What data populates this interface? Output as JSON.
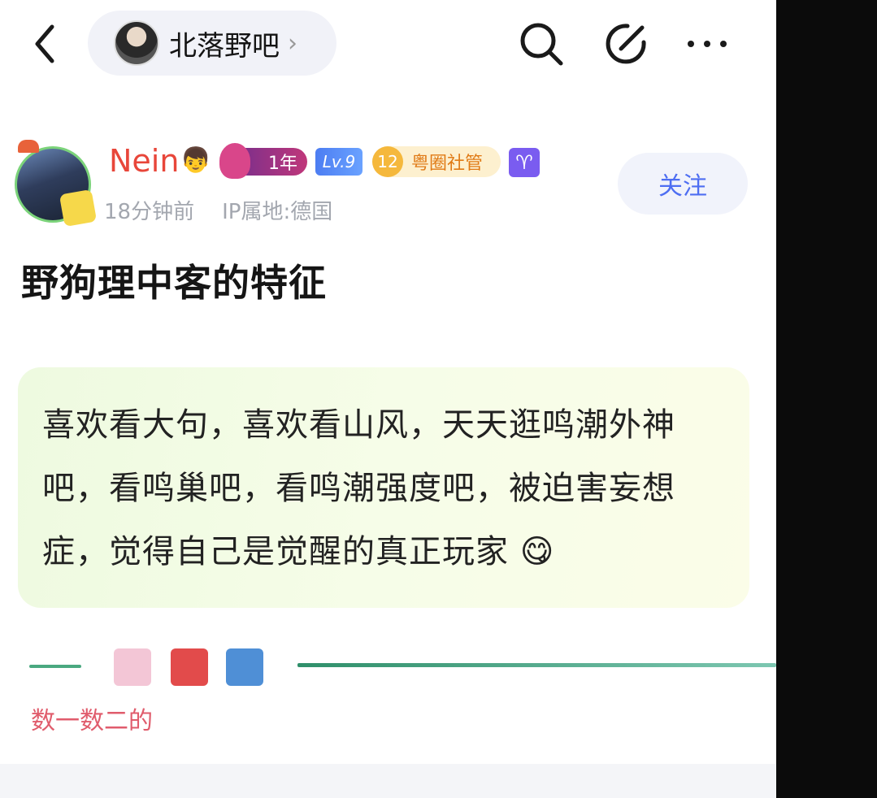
{
  "topbar": {
    "forum_name": "北落野吧",
    "forum_chevron": "›",
    "icons": [
      "back-arrow-icon",
      "search-icon",
      "edit-icon",
      "more-icon"
    ]
  },
  "post": {
    "author": {
      "nickname": "Nein",
      "nickname_emoji": "👦",
      "badge_year": "1年",
      "badge_level": "Lv.9",
      "badge_admin_num": "12",
      "badge_admin_label": "粤圈社管",
      "badge_zodiac": "♈",
      "time": "18分钟前",
      "ip": "IP属地:德国"
    },
    "follow_label": "关注",
    "title": "野狗理中客的特征",
    "body": "喜欢看大句，喜欢看山风，天天逛鸣潮外神吧，看鸣巢吧，看鸣潮强度吧，被迫害妄想症，觉得自己是觉醒的真正玩家 😋",
    "signature": "数一数二的"
  },
  "colors": {
    "accent": "#4e6ef2",
    "nickname": "#e8463a",
    "signature": "#e05c6c",
    "bubble": "#eefae0"
  }
}
